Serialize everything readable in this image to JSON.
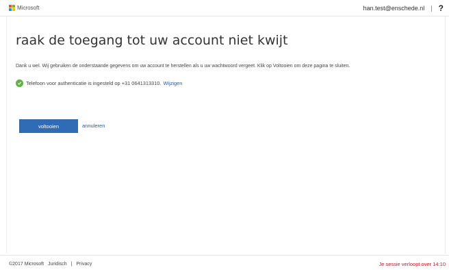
{
  "header": {
    "logo_text": "Microsoft",
    "user_email": "han.test@enschede.nl",
    "separator": "|",
    "help_label": "?"
  },
  "main": {
    "title": "raak de toegang tot uw account niet kwijt",
    "description": "Dank u wel. Wij gebruiken de onderstaande gegevens om uw account te herstellen als u uw wachtwoord vergeet. Klik op Voltooien om deze pagina te sluiten.",
    "status": {
      "icon": "check-circle-icon",
      "text": "Telefoon voor authenticatie is ingesteld op +31 0641313310.",
      "change_link": "Wijzigen"
    },
    "finish_button": "voltooien",
    "cancel_link": "annuleren"
  },
  "footer": {
    "copyright": "©2017 Microsoft",
    "legal_link": "Juridisch",
    "separator": "|",
    "privacy_link": "Privacy",
    "session_timer": "Je sessie verloopt over 14:10"
  },
  "colors": {
    "accent": "#2f6cb5",
    "link": "#1d5aa8",
    "success": "#5cb53b",
    "warning_text": "#e81123",
    "logo": [
      "#f25022",
      "#7fba00",
      "#00a4ef",
      "#ffb900"
    ]
  }
}
